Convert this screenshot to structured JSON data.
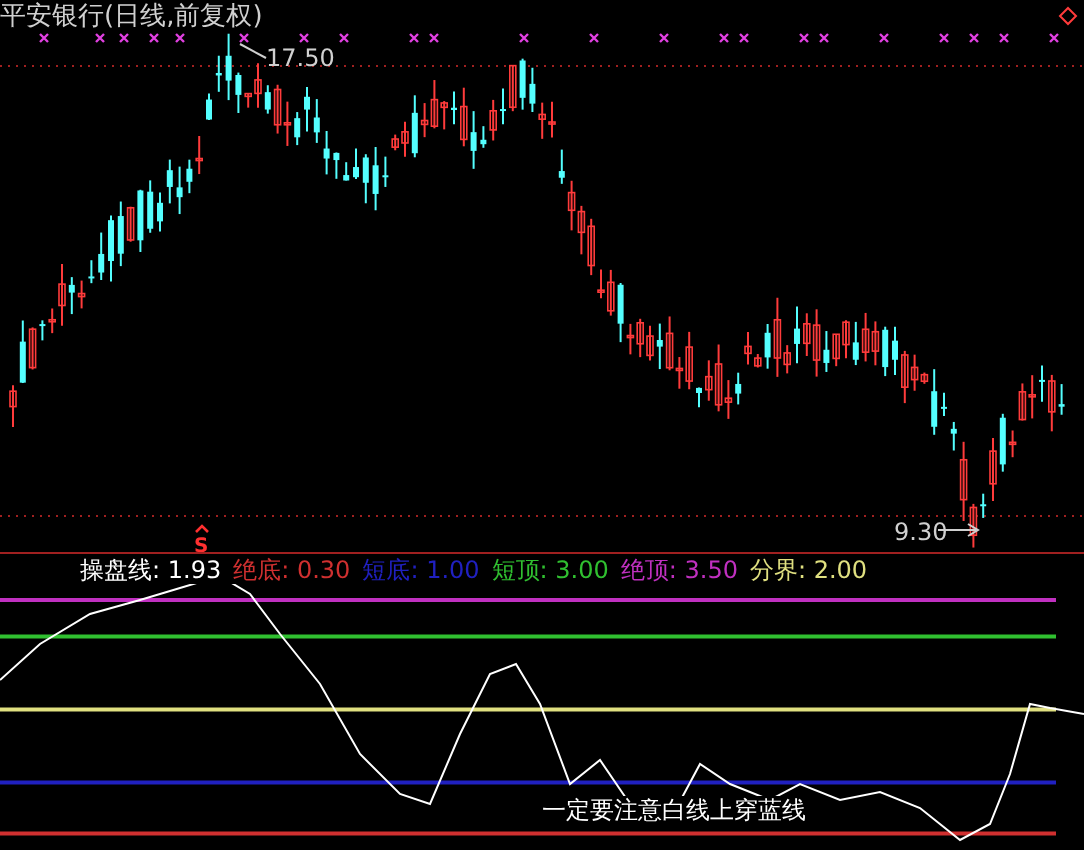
{
  "chart": {
    "title": "平安银行(日线,前复权)",
    "high_label": "17.50",
    "low_label": "9.30",
    "signal": "S"
  },
  "indicator": {
    "name": "操盘线:",
    "value": "1.93",
    "levels": [
      {
        "label": "绝底:",
        "value": "0.30",
        "color": "#d03030"
      },
      {
        "label": "短底:",
        "value": "1.00",
        "color": "#2020c0"
      },
      {
        "label": "短顶:",
        "value": "3.00",
        "color": "#30c030"
      },
      {
        "label": "绝顶:",
        "value": "3.50",
        "color": "#c030c0"
      },
      {
        "label": "分界:",
        "value": "2.00",
        "color": "#e0e080"
      }
    ],
    "note": "一定要注意白线上穿蓝线"
  }
}
